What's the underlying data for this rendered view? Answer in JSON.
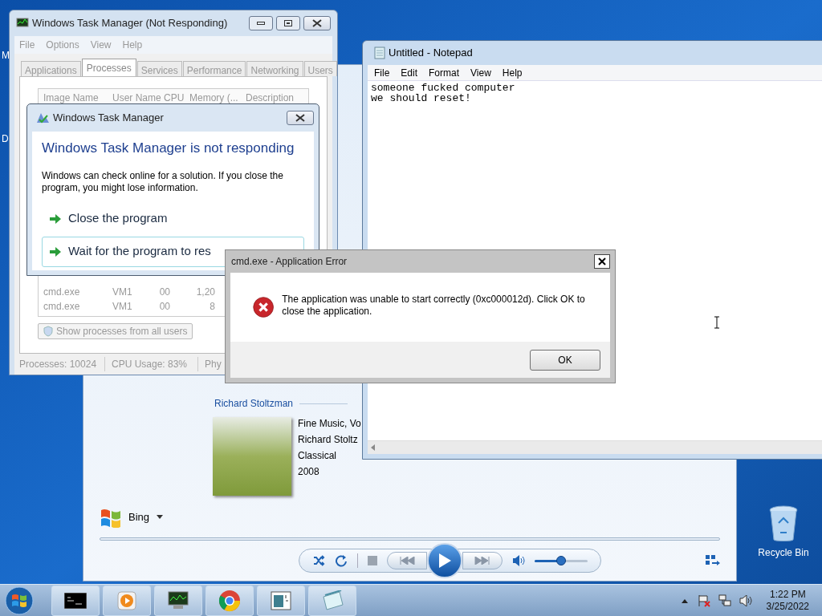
{
  "desktop": {
    "partial_icon_labels": [
      "M",
      "D"
    ],
    "recycle_bin": "Recycle Bin"
  },
  "media_player": {
    "artist_heading": "Richard Stoltzman",
    "album_info": [
      "Fine Music, Vo",
      "Richard Stoltz",
      "Classical",
      "2008"
    ],
    "search_provider": "Bing",
    "volume": {
      "level": 0.5
    }
  },
  "task_manager": {
    "title": "Windows Task Manager (Not Responding)",
    "menu": [
      "File",
      "Options",
      "View",
      "Help"
    ],
    "tabs": [
      {
        "label": "Applications",
        "selected": false
      },
      {
        "label": "Processes",
        "selected": true
      },
      {
        "label": "Services",
        "selected": false
      },
      {
        "label": "Performance",
        "selected": false
      },
      {
        "label": "Networking",
        "selected": false
      },
      {
        "label": "Users",
        "selected": false
      }
    ],
    "columns": [
      "Image Name",
      "User Name",
      "CPU",
      "Memory (...",
      "Description"
    ],
    "rows": [
      [
        "cmd.exe",
        "VM1",
        "00",
        "1,20"
      ],
      [
        "cmd.exe",
        "VM1",
        "00",
        "8"
      ]
    ],
    "show_all_button": "Show processes from all users",
    "status_bar": [
      "Processes: 10024",
      "CPU Usage: 83%",
      "Phy"
    ]
  },
  "not_responding_dialog": {
    "title": "Windows Task Manager",
    "heading": "Windows Task Manager is not responding",
    "message": "Windows can check online for a solution. If you close the program, you might lose information.",
    "options": [
      {
        "label": "Close the program",
        "selected": false
      },
      {
        "label": "Wait for the program to res",
        "selected": true
      }
    ]
  },
  "notepad": {
    "title": "Untitled - Notepad",
    "menu": [
      "File",
      "Edit",
      "Format",
      "View",
      "Help"
    ],
    "lines": [
      "someone fucked computer",
      "we should reset!"
    ]
  },
  "error_dialog": {
    "title": "cmd.exe - Application Error",
    "message": "The application was unable to start correctly (0xc000012d). Click OK to close the application.",
    "button": "OK"
  },
  "taskbar": {
    "time": "1:22 PM",
    "date": "3/25/2022"
  }
}
